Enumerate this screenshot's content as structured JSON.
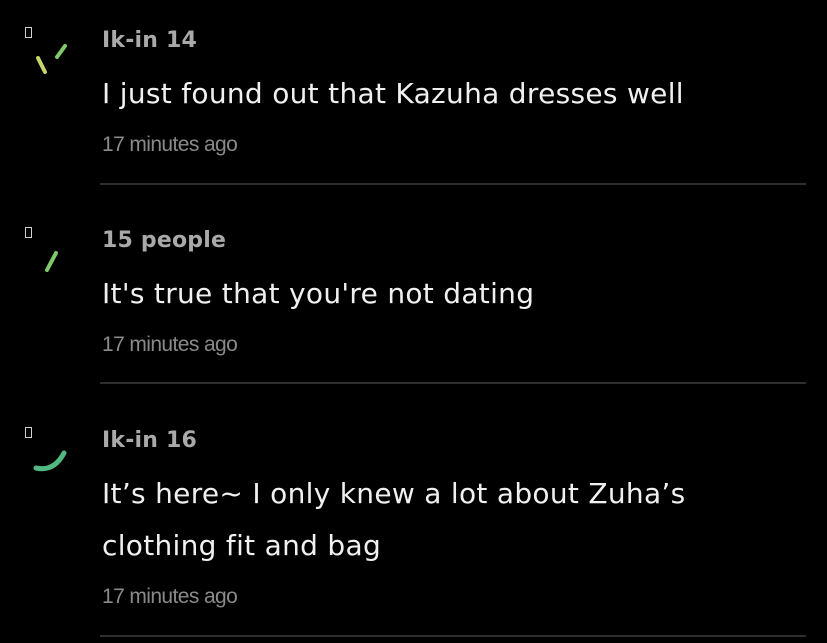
{
  "comments": [
    {
      "author": "Ik-in 14",
      "text": "I just found out that Kazuha dresses well",
      "time": "17 minutes ago",
      "avatar_icon": "loading-spinner-icon",
      "avatar_color": "#c8d46a"
    },
    {
      "author": "15 people",
      "text": "It's true that you're not dating",
      "time": "17 minutes ago",
      "avatar_icon": "loading-spinner-icon",
      "avatar_color": "#7fc96a"
    },
    {
      "author": "Ik-in 16",
      "text": "It’s here~ I only knew a lot about Zuha’s clothing fit and bag",
      "time": "17 minutes ago",
      "avatar_icon": "loading-spinner-icon",
      "avatar_color": "#52b882"
    }
  ]
}
